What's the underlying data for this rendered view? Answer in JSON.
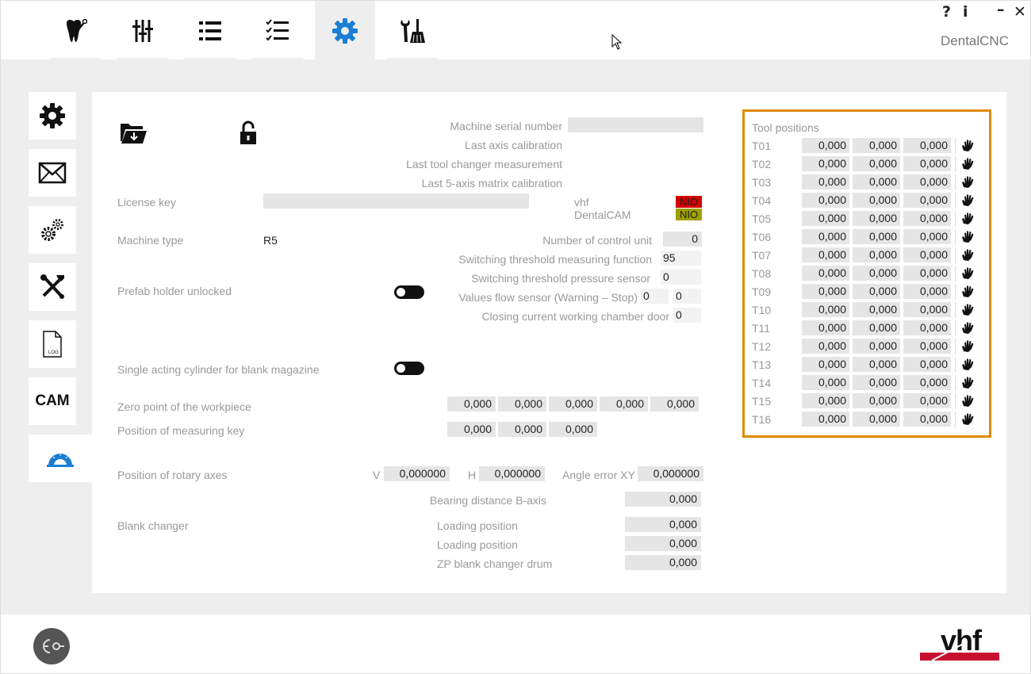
{
  "app": {
    "title": "DentalCNC",
    "help": "?",
    "info": "i",
    "minimize": "–",
    "close": "✕"
  },
  "top_tabs": [
    {
      "icon": "tooth-icon",
      "active": false
    },
    {
      "icon": "sliders-icon",
      "active": false
    },
    {
      "icon": "list-icon",
      "active": false
    },
    {
      "icon": "checklist-icon",
      "active": false
    },
    {
      "icon": "gear-icon",
      "active": true
    },
    {
      "icon": "tools-brush-icon",
      "active": false
    }
  ],
  "side_tabs": [
    {
      "icon": "gear-icon"
    },
    {
      "icon": "envelope-icon"
    },
    {
      "icon": "gears-icon"
    },
    {
      "icon": "wrench-screwdriver-icon"
    },
    {
      "icon": "log-file-icon",
      "label": "LOG"
    },
    {
      "icon": "cam-icon",
      "label": "CAM"
    },
    {
      "icon": "protractor-icon",
      "active": true
    }
  ],
  "info": {
    "machine_serial_number": "Machine serial number",
    "last_axis_calibration": "Last axis calibration",
    "last_tool_changer_measurement": "Last tool changer measurement",
    "last_5axis_matrix_calibration": "Last 5-axis matrix calibration"
  },
  "license": {
    "label": "License key",
    "value": "",
    "vhf_label": "vhf",
    "vhf_status": "NIO",
    "vhf_color": "#d40000",
    "dentalcam_label": "DentalCAM",
    "dentalcam_status": "NIO",
    "dentalcam_color": "#a0a000"
  },
  "machine_type": {
    "label": "Machine type",
    "value": "R5"
  },
  "control_unit": {
    "label": "Number of control unit",
    "value": "0"
  },
  "switching_measuring": {
    "label": "Switching threshold measuring function",
    "value": "95"
  },
  "switching_pressure": {
    "label": "Switching threshold pressure sensor",
    "value": "0"
  },
  "flow_sensor": {
    "label": "Values flow sensor (Warning – Stop)",
    "warning": "0",
    "stop": "0"
  },
  "closing_current": {
    "label": "Closing current working chamber door",
    "value": "0"
  },
  "prefab_holder": {
    "label": "Prefab holder unlocked",
    "on": false
  },
  "single_cylinder": {
    "label": "Single acting cylinder for blank magazine",
    "on": false
  },
  "zero_point": {
    "label": "Zero point of the workpiece",
    "values": [
      "0,000",
      "0,000",
      "0,000",
      "0,000",
      "0,000"
    ]
  },
  "measuring_key": {
    "label": "Position of measuring key",
    "values": [
      "0,000",
      "0,000",
      "0,000"
    ]
  },
  "rotary_axes": {
    "label": "Position of rotary axes",
    "v_label": "V",
    "v_value": "0,000000",
    "h_label": "H",
    "h_value": "0,000000",
    "angle_label": "Angle error XY",
    "angle_value": "0,000000"
  },
  "bearing_distance": {
    "label": "Bearing distance B-axis",
    "value": "0,000"
  },
  "blank_changer": {
    "label": "Blank changer",
    "rows": [
      {
        "label": "Loading position",
        "value": "0,000"
      },
      {
        "label": "Loading position",
        "value": "0,000"
      },
      {
        "label": "ZP blank changer drum",
        "value": "0,000"
      }
    ]
  },
  "tool_positions": {
    "title": "Tool positions",
    "highlight_color": "#e08a00",
    "tools": [
      {
        "name": "T01",
        "values": [
          "0,000",
          "0,000",
          "0,000"
        ]
      },
      {
        "name": "T02",
        "values": [
          "0,000",
          "0,000",
          "0,000"
        ]
      },
      {
        "name": "T03",
        "values": [
          "0,000",
          "0,000",
          "0,000"
        ]
      },
      {
        "name": "T04",
        "values": [
          "0,000",
          "0,000",
          "0,000"
        ]
      },
      {
        "name": "T05",
        "values": [
          "0,000",
          "0,000",
          "0,000"
        ]
      },
      {
        "name": "T06",
        "values": [
          "0,000",
          "0,000",
          "0,000"
        ]
      },
      {
        "name": "T07",
        "values": [
          "0,000",
          "0,000",
          "0,000"
        ]
      },
      {
        "name": "T08",
        "values": [
          "0,000",
          "0,000",
          "0,000"
        ]
      },
      {
        "name": "T09",
        "values": [
          "0,000",
          "0,000",
          "0,000"
        ]
      },
      {
        "name": "T10",
        "values": [
          "0,000",
          "0,000",
          "0,000"
        ]
      },
      {
        "name": "T11",
        "values": [
          "0,000",
          "0,000",
          "0,000"
        ]
      },
      {
        "name": "T12",
        "values": [
          "0,000",
          "0,000",
          "0,000"
        ]
      },
      {
        "name": "T13",
        "values": [
          "0,000",
          "0,000",
          "0,000"
        ]
      },
      {
        "name": "T14",
        "values": [
          "0,000",
          "0,000",
          "0,000"
        ]
      },
      {
        "name": "T15",
        "values": [
          "0,000",
          "0,000",
          "0,000"
        ]
      },
      {
        "name": "T16",
        "values": [
          "0,000",
          "0,000",
          "0,000"
        ]
      }
    ]
  },
  "footer": {
    "logo_text": "vhf",
    "logo_color": "#c8102e",
    "disconnect_icon": "plug-disconnect-icon"
  }
}
